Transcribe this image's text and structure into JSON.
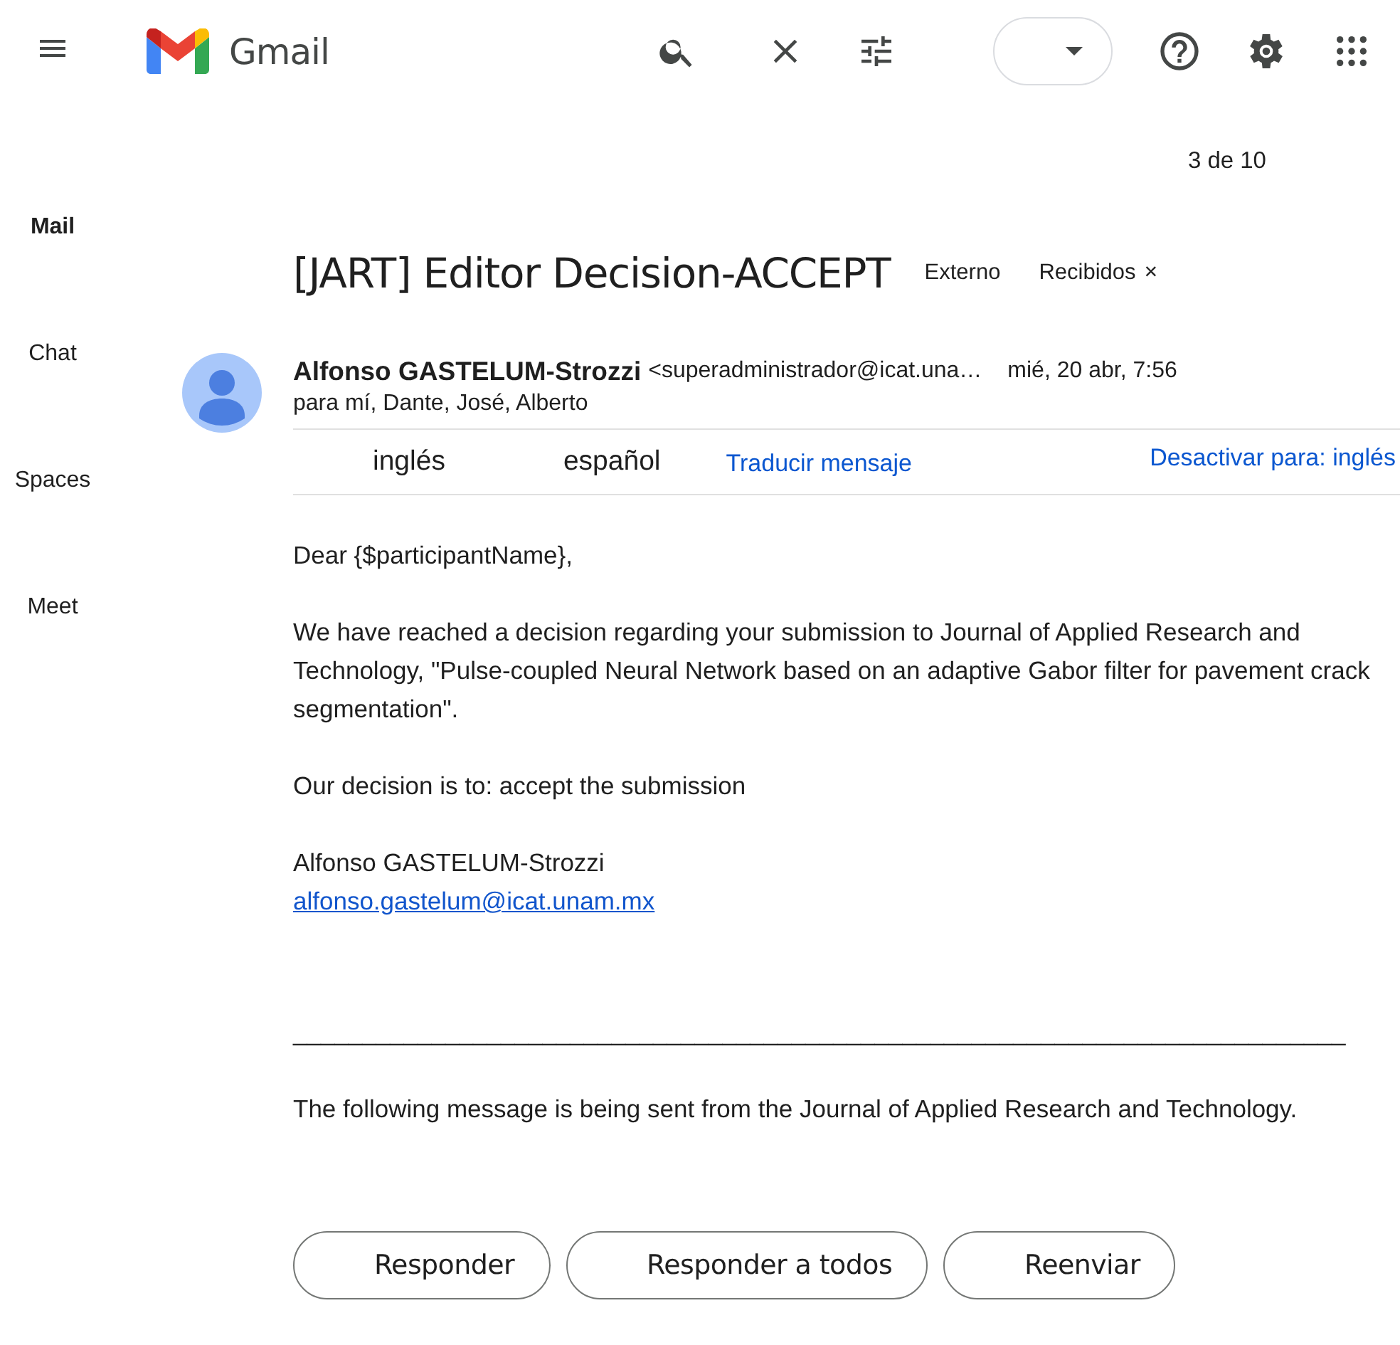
{
  "header": {
    "app_name": "Gmail"
  },
  "nav": [
    {
      "label": "Mail",
      "selected": true
    },
    {
      "label": "Chat",
      "selected": false
    },
    {
      "label": "Spaces",
      "selected": false
    },
    {
      "label": "Meet",
      "selected": false
    }
  ],
  "pager": "3 de 10",
  "message": {
    "subject": "[JART] Editor Decision-ACCEPT",
    "labels": [
      {
        "text": "Externo",
        "removable": false
      },
      {
        "text": "Recibidos",
        "removable": true,
        "remove": "×"
      }
    ],
    "sender_name": "Alfonso GASTELUM-Strozzi",
    "sender_email": "<superadministrador@icat.una…",
    "date": "mié, 20 abr, 7:56",
    "recipients": "para mí, Dante, José, Alberto",
    "translate": {
      "languages": [
        {
          "label": "inglés",
          "selected": false
        },
        {
          "label": "español",
          "selected": false
        }
      ],
      "action": "Traducir mensaje",
      "disable": "Desactivar para: inglés"
    },
    "body": [
      {
        "kind": "text",
        "text": "Dear {$participantName},"
      },
      {
        "kind": "text",
        "text": "We have reached a decision regarding your submission to Journal of Applied Research and Technology, \"Pulse-coupled Neural Network based on an adaptive Gabor filter for pavement crack segmentation\"."
      },
      {
        "kind": "text",
        "text": "Our decision is to: accept the submission"
      },
      {
        "kind": "signature",
        "text": "Alfonso GASTELUM-Strozzi",
        "link": "alfonso.gastelum@icat.unam.mx"
      },
      {
        "kind": "rule",
        "text": "____________________________________________________________________________"
      },
      {
        "kind": "text",
        "text": "The following message is being sent from the Journal of Applied Research and Technology."
      }
    ],
    "actions": [
      "Responder",
      "Responder a todos",
      "Reenviar"
    ]
  }
}
